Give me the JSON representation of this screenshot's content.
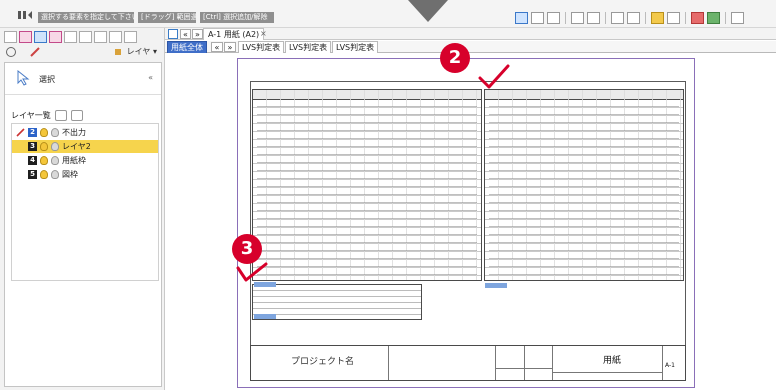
{
  "command_bar": {
    "hints": [
      "選択する要素を指定して下さい。",
      "[ドラッグ] 範囲選択",
      "[Ctrl] 選択追加/解除"
    ]
  },
  "left_tools": {
    "layer_button": "レイヤ ▾"
  },
  "selection_panel": {
    "title": "選択",
    "collapse": "«"
  },
  "layers": {
    "list_label": "レイヤ一覧",
    "items": [
      {
        "num": "2",
        "label": "不出力",
        "selected": false
      },
      {
        "num": "3",
        "label": "レイヤ2",
        "selected": true
      },
      {
        "num": "4",
        "label": "用紙枠",
        "selected": false
      },
      {
        "num": "5",
        "label": "図枠",
        "selected": false
      }
    ]
  },
  "document": {
    "nav_prev": "«",
    "nav_next": "»",
    "tab_label": "A-1 用紙 (A2)",
    "close": "×"
  },
  "sheet_tabs": {
    "active": "用紙全体",
    "nav_prev": "«",
    "nav_next": "»",
    "tabs": [
      "LVS判定表",
      "LVS判定表",
      "LVS判定表"
    ]
  },
  "title_block": {
    "project_name": "プロジェクト名",
    "sheet_name": "用紙",
    "sheet_number": "A-1"
  },
  "callouts": {
    "c2": "2",
    "c3": "3"
  },
  "colors": {
    "callout_red": "#d7002b",
    "check_red": "#d7002b",
    "active_tab_blue": "#3f6ec8",
    "selected_layer_yellow": "#f6d44d"
  }
}
